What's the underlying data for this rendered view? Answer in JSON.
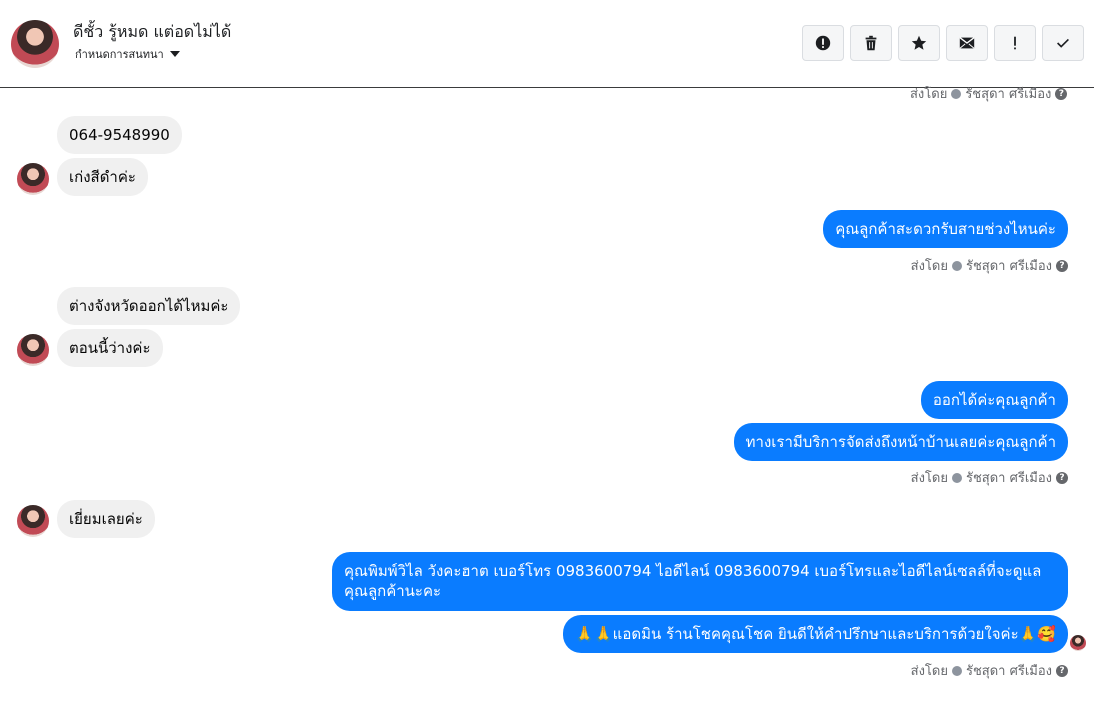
{
  "header": {
    "contact_name": "ดีชั้ว รู้หมด แต่อดไม่ได้",
    "assign_label": "กำหนดการสนทนา"
  },
  "toolbar": {
    "icons": [
      "alert-circle-icon",
      "trash-icon",
      "star-icon",
      "envelope-icon",
      "exclamation-icon",
      "check-icon"
    ]
  },
  "top_meta": {
    "sent_by": "ส่งโดย",
    "agent": "รัชสุดา ศรีเมือง"
  },
  "messages": {
    "m1": "064-9548990",
    "m2": "เก่งสีดำค่ะ",
    "m3": "คุณลูกค้าสะดวกรับสายช่วงไหนค่ะ",
    "m4": "ต่างจังหวัดออกได้ไหมค่ะ",
    "m5": "ตอนนี้ว่างค่ะ",
    "m6": "ออกได้ค่ะคุณลูกค้า",
    "m7": "ทางเรามีบริการจัดส่งถึงหน้าบ้านเลยค่ะคุณลูกค้า",
    "m8": "เยี่ยมเลยค่ะ",
    "m9_line1": "คุณพิมพ์วิไล วังคะฮาต   เบอร์โทร 0983600794  ไอดีไลน์ 0983600794   เบอร์โทรและไอดีไลน์เซลล์ที่จะดูแล",
    "m9_line2": "คุณลูกค้านะคะ",
    "m10": "🙏🙏แอดมิน ร้านโชคคุณโชค ยินดีให้คำปรึกษาและบริการด้วยใจค่ะ🙏🥰"
  },
  "meta": {
    "sent_by": "ส่งโดย",
    "agent": "รัชสุดา ศรีเมือง",
    "help": "?"
  }
}
